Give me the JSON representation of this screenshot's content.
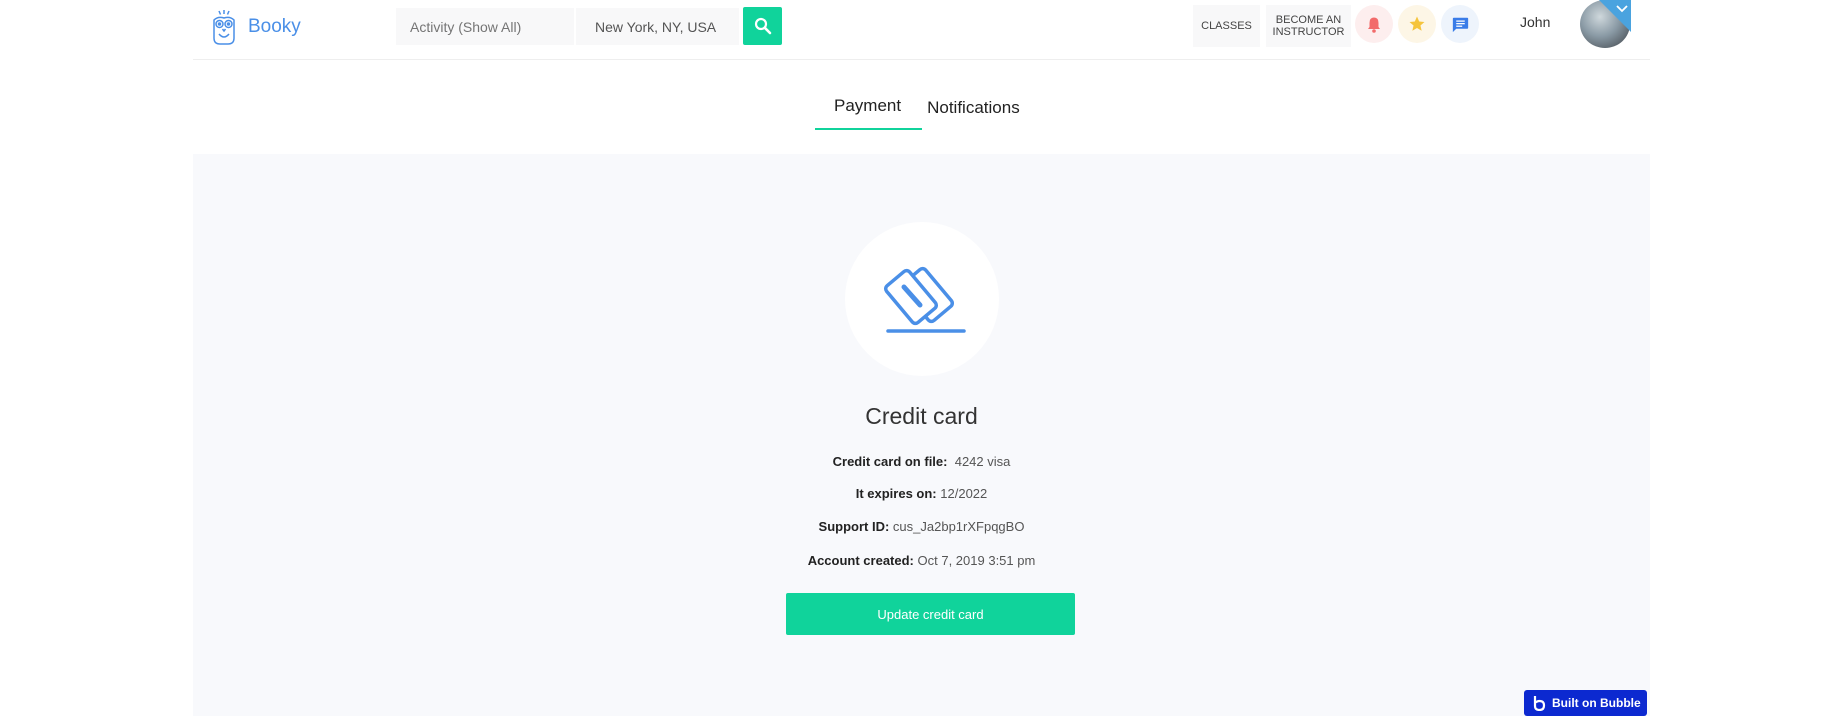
{
  "header": {
    "logo_text": "Booky",
    "search_activity_placeholder": "Activity (Show All)",
    "search_location_value": "New York, NY, USA",
    "nav_classes": "CLASSES",
    "nav_instructor_line1": "BECOME AN",
    "nav_instructor_line2": "INSTRUCTOR",
    "user_name": "John",
    "icons": [
      "owl-logo-icon",
      "search-icon",
      "bell-icon",
      "star-icon",
      "chat-icon",
      "chevron-down-icon"
    ]
  },
  "tabs": [
    {
      "label": "Payment",
      "active": true
    },
    {
      "label": "Notifications",
      "active": false
    }
  ],
  "credit_card": {
    "title": "Credit  card",
    "on_file_label": "Credit card on file:",
    "on_file_value": "4242 visa",
    "expires_label": "It expires on:",
    "expires_value": "12/2022",
    "support_label": "Support ID:",
    "support_value": "cus_Ja2bp1rXFpqgBO",
    "created_label": "Account created:",
    "created_value": "Oct 7, 2019 3:51 pm",
    "update_button": "Update credit card"
  },
  "badge": {
    "label": "Built on Bubble"
  },
  "colors": {
    "accent": "#10d39b",
    "brand_blue": "#4a8fe7",
    "panel_bg": "#f8f9fc",
    "badge_blue": "#0c29d0"
  }
}
